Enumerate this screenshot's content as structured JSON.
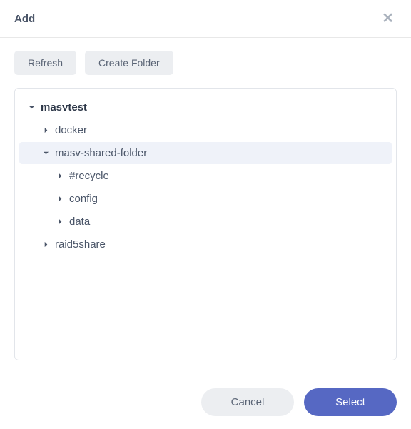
{
  "header": {
    "title": "Add"
  },
  "toolbar": {
    "refresh_label": "Refresh",
    "create_folder_label": "Create Folder"
  },
  "tree": [
    {
      "label": "masvtest",
      "expanded": true,
      "indent": 0,
      "root": true,
      "selected": false
    },
    {
      "label": "docker",
      "expanded": false,
      "indent": 1,
      "root": false,
      "selected": false
    },
    {
      "label": "masv-shared-folder",
      "expanded": true,
      "indent": 1,
      "root": false,
      "selected": true
    },
    {
      "label": "#recycle",
      "expanded": false,
      "indent": 2,
      "root": false,
      "selected": false
    },
    {
      "label": "config",
      "expanded": false,
      "indent": 2,
      "root": false,
      "selected": false
    },
    {
      "label": "data",
      "expanded": false,
      "indent": 2,
      "root": false,
      "selected": false
    },
    {
      "label": "raid5share",
      "expanded": false,
      "indent": 1,
      "root": false,
      "selected": false
    }
  ],
  "footer": {
    "cancel_label": "Cancel",
    "select_label": "Select"
  }
}
